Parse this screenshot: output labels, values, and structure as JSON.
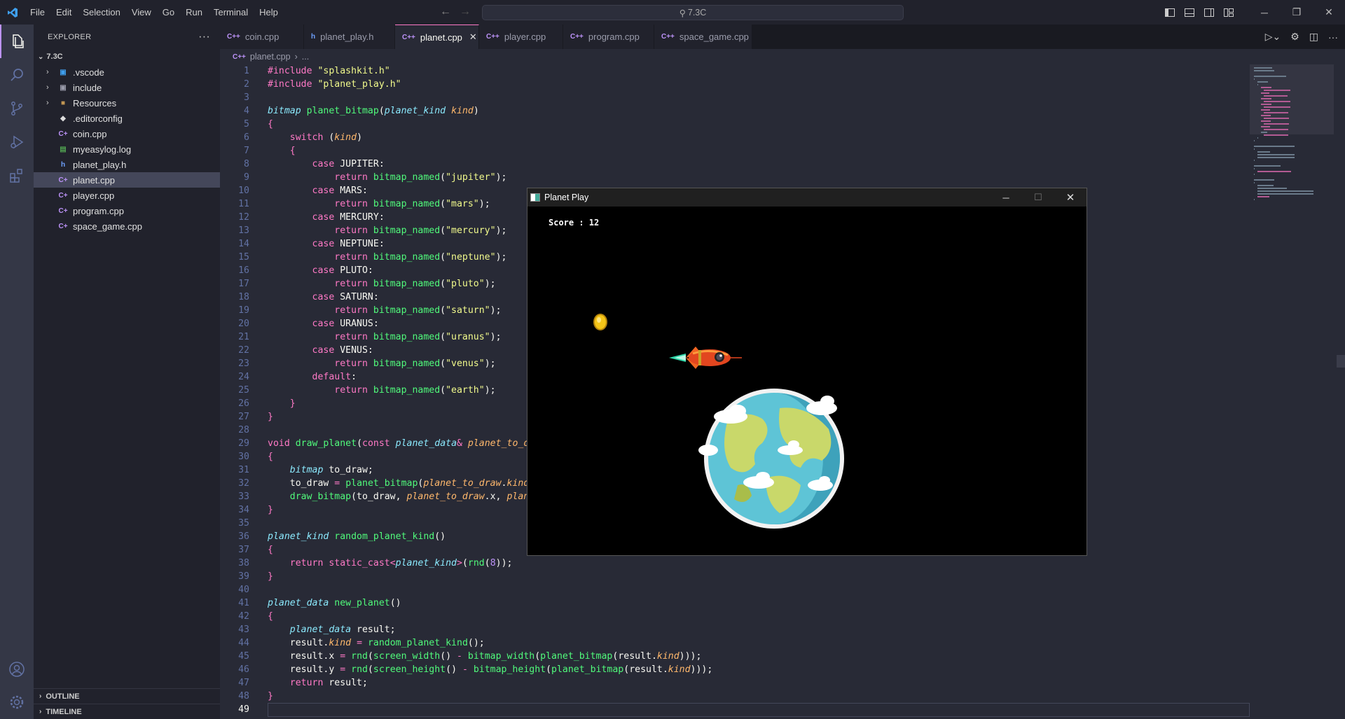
{
  "titlebar": {
    "menu": [
      "File",
      "Edit",
      "Selection",
      "View",
      "Go",
      "Run",
      "Terminal",
      "Help"
    ],
    "search": "7.3C"
  },
  "sidebar": {
    "header": "EXPLORER",
    "root": "7.3C",
    "items": [
      {
        "label": ".vscode",
        "type": "folder",
        "icon": "vscode-folder-icon"
      },
      {
        "label": "include",
        "type": "folder",
        "icon": "include-folder-icon"
      },
      {
        "label": "Resources",
        "type": "folder",
        "icon": "folder-icon"
      },
      {
        "label": ".editorconfig",
        "type": "file",
        "icon": "editorconfig-icon"
      },
      {
        "label": "coin.cpp",
        "type": "file",
        "icon": "cpp-file-icon"
      },
      {
        "label": "myeasylog.log",
        "type": "file",
        "icon": "log-file-icon"
      },
      {
        "label": "planet_play.h",
        "type": "file",
        "icon": "header-file-icon"
      },
      {
        "label": "planet.cpp",
        "type": "file",
        "icon": "cpp-file-icon"
      },
      {
        "label": "player.cpp",
        "type": "file",
        "icon": "cpp-file-icon"
      },
      {
        "label": "program.cpp",
        "type": "file",
        "icon": "cpp-file-icon"
      },
      {
        "label": "space_game.cpp",
        "type": "file",
        "icon": "cpp-file-icon"
      }
    ],
    "outline": "OUTLINE",
    "timeline": "TIMELINE"
  },
  "tabs": [
    {
      "label": "coin.cpp",
      "icon": "C++"
    },
    {
      "label": "planet_play.h",
      "icon": "h"
    },
    {
      "label": "planet.cpp",
      "icon": "C++"
    },
    {
      "label": "player.cpp",
      "icon": "C++"
    },
    {
      "label": "program.cpp",
      "icon": "C++"
    },
    {
      "label": "space_game.cpp",
      "icon": "C++"
    }
  ],
  "breadcrumb": {
    "file": "planet.cpp",
    "more": "..."
  },
  "editor": {
    "current_line": 49,
    "lines": [
      "#include \"splashkit.h\"",
      "#include \"planet_play.h\"",
      "",
      "bitmap planet_bitmap(planet_kind kind)",
      "{",
      "    switch (kind)",
      "    {",
      "        case JUPITER:",
      "            return bitmap_named(\"jupiter\");",
      "        case MARS:",
      "            return bitmap_named(\"mars\");",
      "        case MERCURY:",
      "            return bitmap_named(\"mercury\");",
      "        case NEPTUNE:",
      "            return bitmap_named(\"neptune\");",
      "        case PLUTO:",
      "            return bitmap_named(\"pluto\");",
      "        case SATURN:",
      "            return bitmap_named(\"saturn\");",
      "        case URANUS:",
      "            return bitmap_named(\"uranus\");",
      "        case VENUS:",
      "            return bitmap_named(\"venus\");",
      "        default:",
      "            return bitmap_named(\"earth\");",
      "    }",
      "}",
      "",
      "void draw_planet(const planet_data& planet_to_dr",
      "{",
      "    bitmap to_draw;",
      "    to_draw = planet_bitmap(planet_to_draw.kind)",
      "    draw_bitmap(to_draw, planet_to_draw.x, plane",
      "}",
      "",
      "planet_kind random_planet_kind()",
      "{",
      "    return static_cast<planet_kind>(rnd(8));",
      "}",
      "",
      "planet_data new_planet()",
      "{",
      "    planet_data result;",
      "    result.kind = random_planet_kind();",
      "    result.x = rnd(screen_width() - bitmap_width(planet_bitmap(result.kind)));",
      "    result.y = rnd(screen_height() - bitmap_height(planet_bitmap(result.kind)));",
      "    return result;",
      "}",
      ""
    ]
  },
  "game_window": {
    "title": "Planet Play",
    "score_text": "Score : 12",
    "sprites": [
      "coin-sprite",
      "rocket-sprite",
      "earth-planet-sprite"
    ]
  },
  "colors": {
    "accent": "#ff79c6",
    "editor_bg": "#282a36",
    "sidebar_bg": "#21222c"
  }
}
